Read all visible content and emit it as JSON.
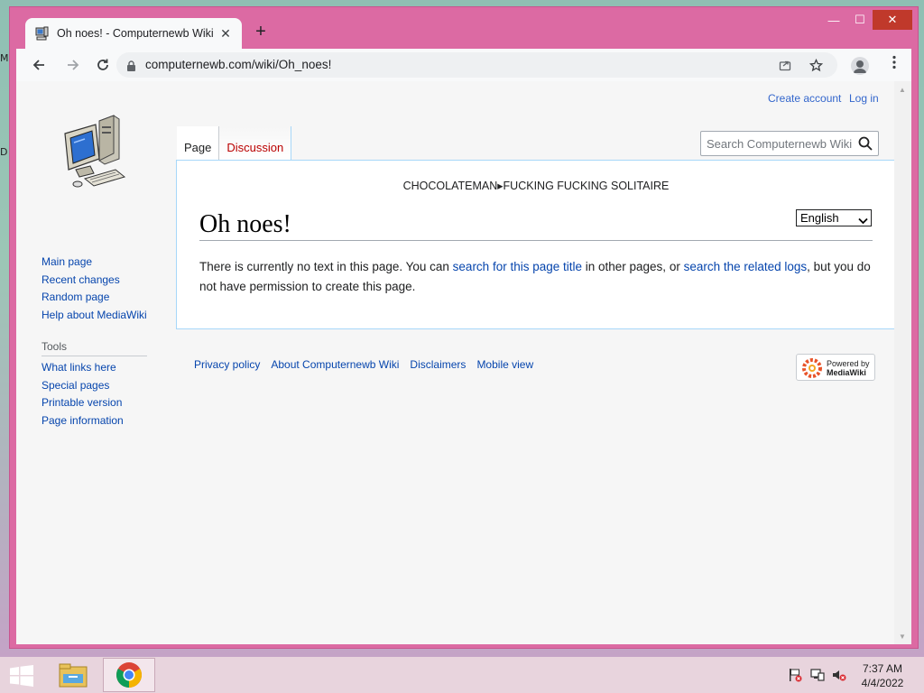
{
  "desktop": {
    "frag_top": "M",
    "frag_bottom": "D"
  },
  "window": {
    "minimize": "—",
    "maximize": "☐",
    "close": "✕"
  },
  "browser": {
    "tab_title": "Oh noes! - Computernewb Wiki",
    "tab_close": "✕",
    "new_tab": "+",
    "url": "computernewb.com/wiki/Oh_noes!"
  },
  "wiki": {
    "personal": {
      "create_account": "Create account",
      "log_in": "Log in"
    },
    "page_tabs": {
      "page": "Page",
      "discussion": "Discussion"
    },
    "search": {
      "placeholder": "Search Computernewb Wiki"
    },
    "navigation": [
      "Main page",
      "Recent changes",
      "Random page",
      "Help about MediaWiki"
    ],
    "tools": {
      "heading": "Tools",
      "items": [
        "What links here",
        "Special pages",
        "Printable version",
        "Page information"
      ]
    },
    "sitenotice": "CHOCOLATEMAN▸FUCKING FUCKING SOLITAIRE",
    "title": "Oh noes!",
    "language": "English",
    "body": {
      "t1": "There is currently no text in this page. You can ",
      "l1": "search for this page title",
      "t2": " in other pages, or ",
      "l2": "search the related logs",
      "t3": ", but you do not have permission to create this page."
    },
    "footer": [
      "Privacy policy",
      "About Computernewb Wiki",
      "Disclaimers",
      "Mobile view"
    ],
    "powered_by": {
      "line1": "Powered by",
      "line2": "MediaWiki"
    }
  },
  "taskbar": {
    "time": "7:37 AM",
    "date": "4/4/2022"
  },
  "colors": {
    "window_frame": "#dc6aa3",
    "link": "#0645ad",
    "new_link": "#ba0000",
    "close_button": "#c0392b"
  }
}
